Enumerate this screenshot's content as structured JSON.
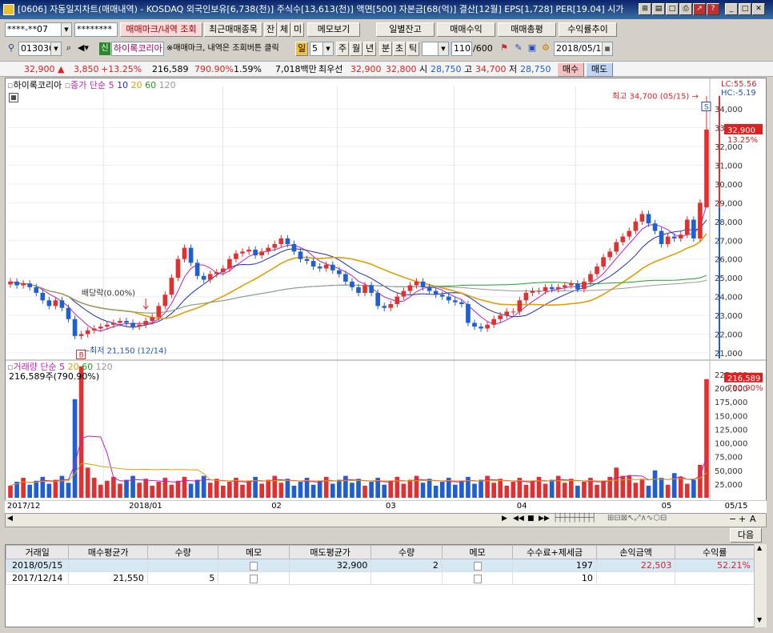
{
  "window": {
    "title": "[0606] 자동일지차트(매매내역) - KOSDAQ 외국인보유[6,738(천)] 주식수[13,613(천)] 액면[500] 자본금[68(억)] 결산[12월] EPS[1,728] PER[19.04] 시가"
  },
  "toolbar1": {
    "account": "****-**07",
    "password": "********",
    "trade_mark_button": "매매마크/내역 조회",
    "recent_button": "최근매매종목",
    "jan_button": "잔",
    "che_button": "체",
    "mi_button": "미",
    "memo_button": "메모보기",
    "daily_balance_button": "일별잔고",
    "trade_profit_button": "매매수익",
    "trade_summary_button": "매매총평",
    "return_trend_button": "수익률추이"
  },
  "toolbar2": {
    "code": "013030",
    "new_badge": "신",
    "stock_name": "하이록코리아",
    "hint": "※매매마크, 내역은 조회버튼 클릭",
    "period_day": "일",
    "period_value": "5",
    "p_week": "주",
    "p_month": "월",
    "p_year": "년",
    "p_min": "분",
    "p_sec": "초",
    "p_tick": "틱",
    "count": "110",
    "total": "/600",
    "date": "2018/05/15"
  },
  "quote": {
    "price": "32,900 ▲",
    "change": "3,850",
    "change_pct": "+13.25%",
    "volume": "216,589",
    "vol_ratio": "790.90%",
    "turnover": "1.59%",
    "amount": "7,018백만",
    "best_ask_label": "최우선",
    "best_ask": "32,900",
    "best_bid": "32,800",
    "open_label": "시",
    "open": "28,750",
    "high_label": "고",
    "high": "34,700",
    "low_label": "저",
    "low": "28,750",
    "buy_button": "매수",
    "sell_button": "매도"
  },
  "chart_data": {
    "type": "candlestick",
    "price_legend": {
      "stock": "하이록코리아",
      "series_title": "종가 단순",
      "ma": [
        "5",
        "10",
        "20",
        "60",
        "120"
      ]
    },
    "volume_legend": {
      "title": "거래량",
      "series_title": "단순",
      "ma": [
        "5",
        "20",
        "60",
        "120"
      ],
      "readout": "216,589주(790.90%)"
    },
    "price_axis": {
      "min": 21000,
      "max": 34000,
      "ticks": [
        "34,000",
        "33,000",
        "32,000",
        "31,000",
        "30,000",
        "29,000",
        "28,000",
        "27,000",
        "26,000",
        "25,000",
        "24,000",
        "23,000",
        "22,000",
        "21,000"
      ],
      "lc": "LC:55.56",
      "hc": "HC:-5.19",
      "last_price": "32,900",
      "last_pct": "13.25%"
    },
    "volume_axis": {
      "max": 225000,
      "ticks": [
        "225,000",
        "200,000",
        "175,000",
        "150,000",
        "125,000",
        "100,000",
        "75,000",
        "50,000",
        "25,000"
      ],
      "last_volume": "216,589",
      "last_pct": "790.90%"
    },
    "x_labels": [
      "2017/12",
      "2018/01",
      "02",
      "03",
      "04",
      "05",
      "05/15"
    ],
    "annotations": {
      "high": "최고 34,700 (05/15)",
      "low": "최저 21,150 (12/14)",
      "dividend": "배당락(0.00%)",
      "buy_mark": "B",
      "sell_mark": "S"
    },
    "closes": [
      24800,
      24600,
      24700,
      24500,
      24200,
      23800,
      23500,
      23800,
      23400,
      22800,
      21900,
      22000,
      22200,
      22300,
      22400,
      22500,
      22600,
      22700,
      22600,
      22400,
      22500,
      22700,
      22900,
      23500,
      24100,
      25000,
      26000,
      26600,
      25800,
      25100,
      24900,
      25200,
      25300,
      25500,
      26000,
      26300,
      26400,
      26500,
      26200,
      26400,
      26600,
      26800,
      27100,
      26800,
      26400,
      26000,
      25900,
      25600,
      25500,
      25700,
      25400,
      25200,
      24800,
      24500,
      24200,
      24600,
      24200,
      23500,
      23400,
      23600,
      24000,
      24300,
      24600,
      24800,
      24500,
      24300,
      24100,
      24000,
      23800,
      23700,
      23600,
      22600,
      22400,
      22300,
      22500,
      22800,
      23000,
      23200,
      23200,
      23800,
      24200,
      24300,
      24300,
      24500,
      24400,
      24500,
      24600,
      24700,
      24400,
      24800,
      25200,
      25600,
      26100,
      26400,
      26900,
      27200,
      27500,
      28000,
      28400,
      27900,
      27500,
      26800,
      27200,
      27100,
      27300,
      28100,
      27100,
      29000,
      32900
    ]
  },
  "nav": {
    "next_button": "다음"
  },
  "trades": {
    "headers": [
      "거래일",
      "매수평균가",
      "수량",
      "메모",
      "매도평균가",
      "수량",
      "메모",
      "수수료+제세금",
      "손익금액",
      "수익률"
    ],
    "rows": [
      [
        "2018/05/15",
        "",
        "",
        "",
        "32,900",
        "2",
        "",
        "197",
        "22,503",
        "52.21%"
      ],
      [
        "2017/12/14",
        "21,550",
        "5",
        "",
        "",
        "",
        "",
        "10",
        "",
        ""
      ]
    ]
  },
  "colors": {
    "up": "#e03030",
    "down": "#1f5fd0",
    "ma5": "#c020c0",
    "ma10": "#2030c0",
    "ma20": "#e0a000",
    "ma60": "#20a020",
    "ma120": "#999999"
  }
}
